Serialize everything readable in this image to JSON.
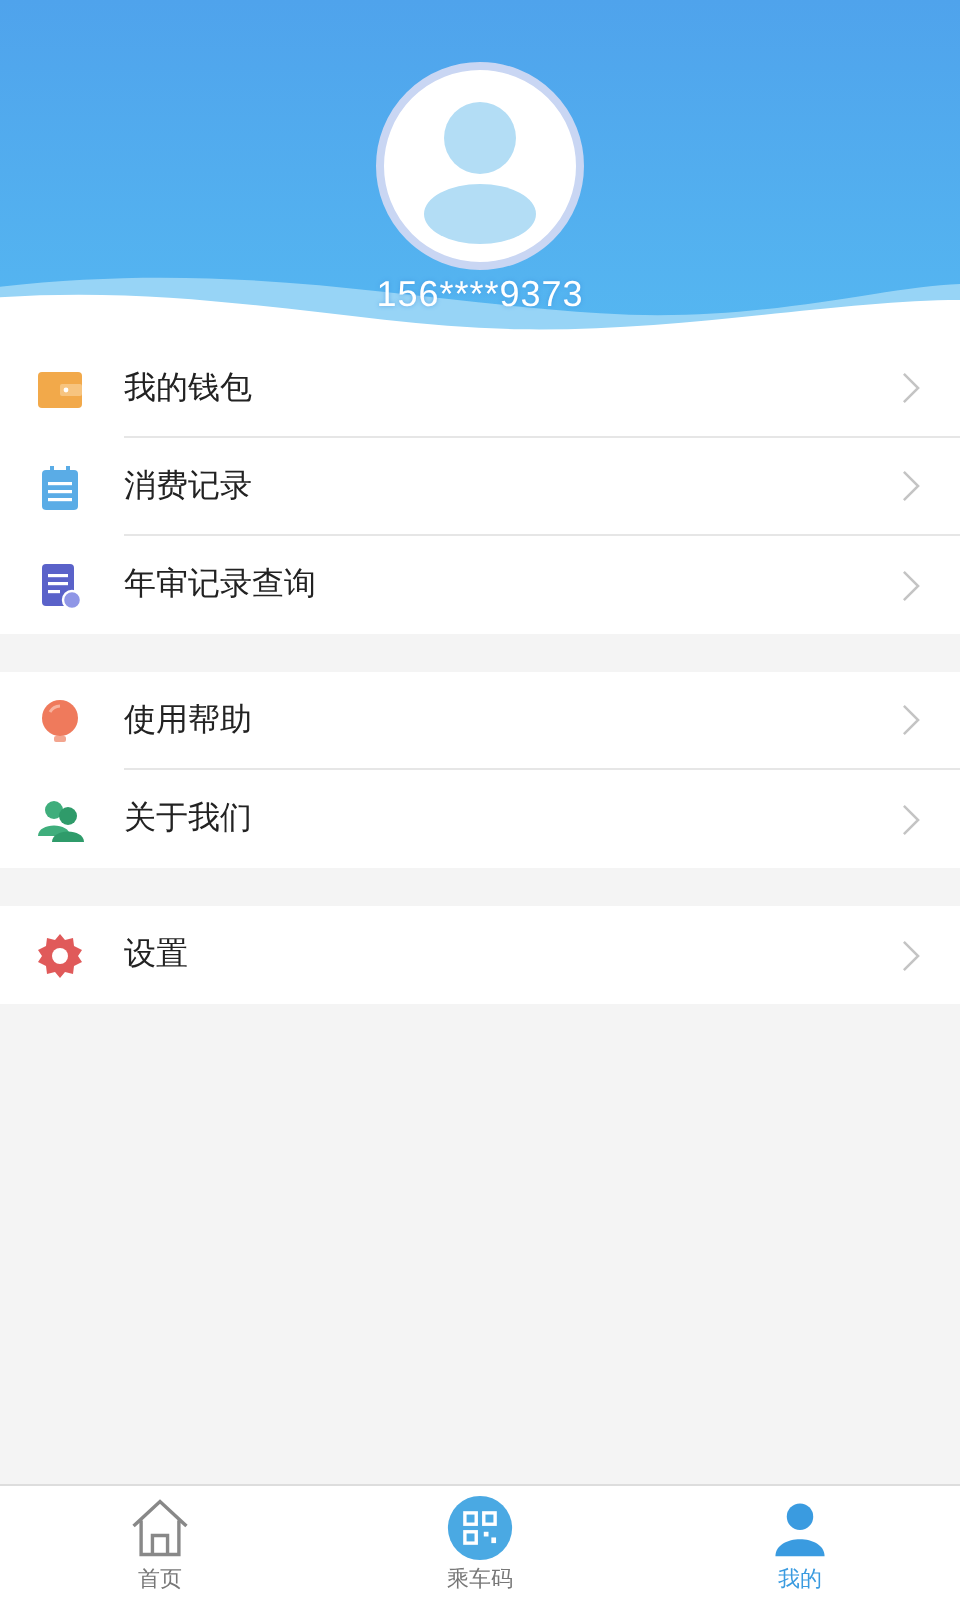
{
  "profile": {
    "phone": "156****9373"
  },
  "menu_groups": [
    {
      "items": [
        {
          "label": "我的钱包",
          "kind": "wallet"
        },
        {
          "label": "消费记录",
          "kind": "list"
        },
        {
          "label": "年审记录查询",
          "kind": "document"
        }
      ]
    },
    {
      "items": [
        {
          "label": "使用帮助",
          "kind": "bulb"
        },
        {
          "label": "关于我们",
          "kind": "people"
        }
      ]
    },
    {
      "items": [
        {
          "label": "设置",
          "kind": "gear"
        }
      ]
    }
  ],
  "tabs": [
    {
      "label": "首页",
      "kind": "home",
      "selected": false
    },
    {
      "label": "乘车码",
      "kind": "qr",
      "selected": false
    },
    {
      "label": "我的",
      "kind": "user",
      "selected": true
    }
  ]
}
